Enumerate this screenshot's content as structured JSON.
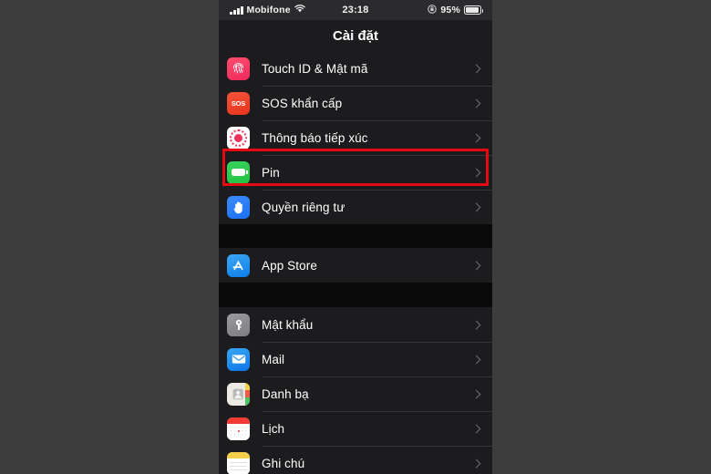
{
  "status_bar": {
    "carrier": "Mobifone",
    "time": "23:18",
    "battery_percent": "95%",
    "signal_icon": "signal-bars-icon",
    "wifi_icon": "wifi-icon",
    "orientation_lock_icon": "rotation-lock-icon",
    "battery_icon": "battery-icon"
  },
  "nav": {
    "title": "Cài đặt"
  },
  "groups": [
    {
      "id": "group-security",
      "rows": [
        {
          "label": "Touch ID & Mật mã",
          "icon": "touch-id-icon",
          "highlighted": false
        },
        {
          "label": "SOS khẩn cấp",
          "icon": "emergency-sos-icon",
          "highlighted": false
        },
        {
          "label": "Thông báo tiếp xúc",
          "icon": "exposure-notification-icon",
          "highlighted": false
        },
        {
          "label": "Pin",
          "icon": "battery-settings-icon",
          "highlighted": true
        },
        {
          "label": "Quyền riêng tư",
          "icon": "privacy-hand-icon",
          "highlighted": false
        }
      ]
    },
    {
      "id": "group-appstore",
      "rows": [
        {
          "label": "App Store",
          "icon": "app-store-icon",
          "highlighted": false
        }
      ]
    },
    {
      "id": "group-apps",
      "rows": [
        {
          "label": "Mật khẩu",
          "icon": "passwords-key-icon",
          "highlighted": false
        },
        {
          "label": "Mail",
          "icon": "mail-icon",
          "highlighted": false
        },
        {
          "label": "Danh bạ",
          "icon": "contacts-icon",
          "highlighted": false
        },
        {
          "label": "Lịch",
          "icon": "calendar-icon",
          "highlighted": false
        },
        {
          "label": "Ghi chú",
          "icon": "notes-icon",
          "highlighted": false
        }
      ]
    }
  ],
  "highlight": {
    "target_label": "Pin",
    "color": "#e50914"
  },
  "colors": {
    "page_background": "#3d3d3d",
    "screen_background": "#0a0a0a",
    "row_background": "#1c1c1e",
    "separator": "#343436",
    "text_primary": "#ffffff",
    "chevron": "#6e6e72"
  }
}
